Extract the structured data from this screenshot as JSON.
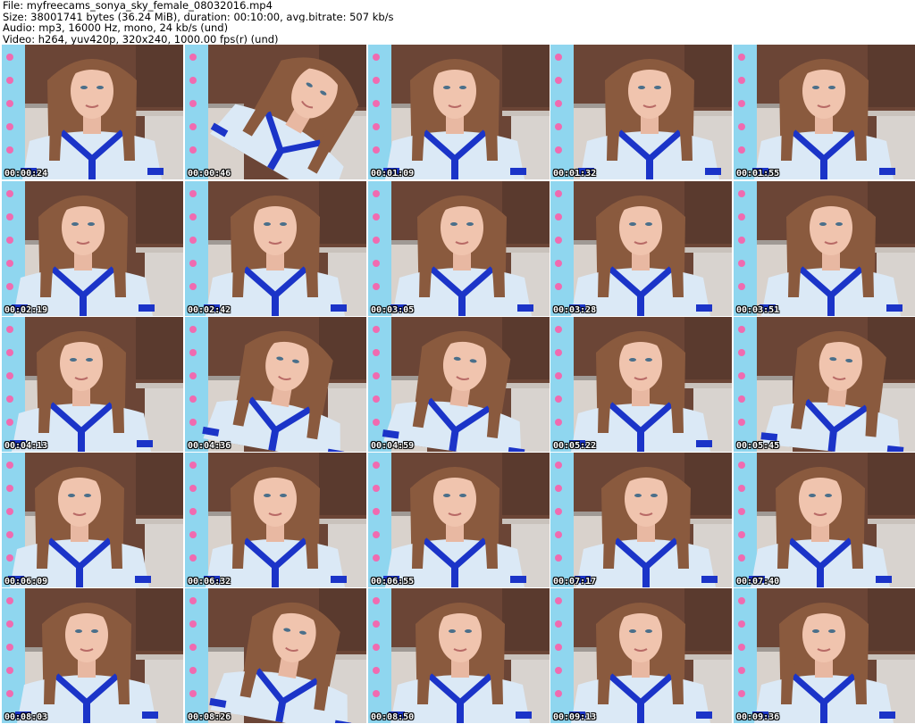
{
  "header": {
    "file_line": "File: myfreecams_sonya_sky_female_08032016.mp4",
    "size_line": "Size: 38001741 bytes (36.24 MiB), duration: 00:10:00, avg.bitrate: 507 kb/s",
    "audio_line": "Audio: mp3, 16000 Hz, mono, 24 kb/s (und)",
    "video_line": "Video: h264, yuv420p, 320x240, 1000.00 fps(r) (und)"
  },
  "thumbnails": [
    {
      "timestamp": "00:00:24"
    },
    {
      "timestamp": "00:00:46"
    },
    {
      "timestamp": "00:01:09"
    },
    {
      "timestamp": "00:01:32"
    },
    {
      "timestamp": "00:01:55"
    },
    {
      "timestamp": "00:02:19"
    },
    {
      "timestamp": "00:02:42"
    },
    {
      "timestamp": "00:03:05"
    },
    {
      "timestamp": "00:03:28"
    },
    {
      "timestamp": "00:03:51"
    },
    {
      "timestamp": "00:04:13"
    },
    {
      "timestamp": "00:04:36"
    },
    {
      "timestamp": "00:04:59"
    },
    {
      "timestamp": "00:05:22"
    },
    {
      "timestamp": "00:05:45"
    },
    {
      "timestamp": "00:06:09"
    },
    {
      "timestamp": "00:06:32"
    },
    {
      "timestamp": "00:06:55"
    },
    {
      "timestamp": "00:07:17"
    },
    {
      "timestamp": "00:07:40"
    },
    {
      "timestamp": "00:08:03"
    },
    {
      "timestamp": "00:08:26"
    },
    {
      "timestamp": "00:08:50"
    },
    {
      "timestamp": "00:09:13"
    },
    {
      "timestamp": "00:09:36"
    }
  ],
  "colors": {
    "background": "#ffffff",
    "header_text": "#000000",
    "timestamp_text": "#ffffff",
    "wall_blue": "#8fd6ef",
    "cabinet_brown": "#6b4536",
    "hair_brown": "#8a5a3e",
    "shirt_light": "#dbe9f6",
    "shirt_trim": "#1b34c8",
    "skin": "#f0c4ae",
    "heart_pink": "#f06bb0"
  }
}
